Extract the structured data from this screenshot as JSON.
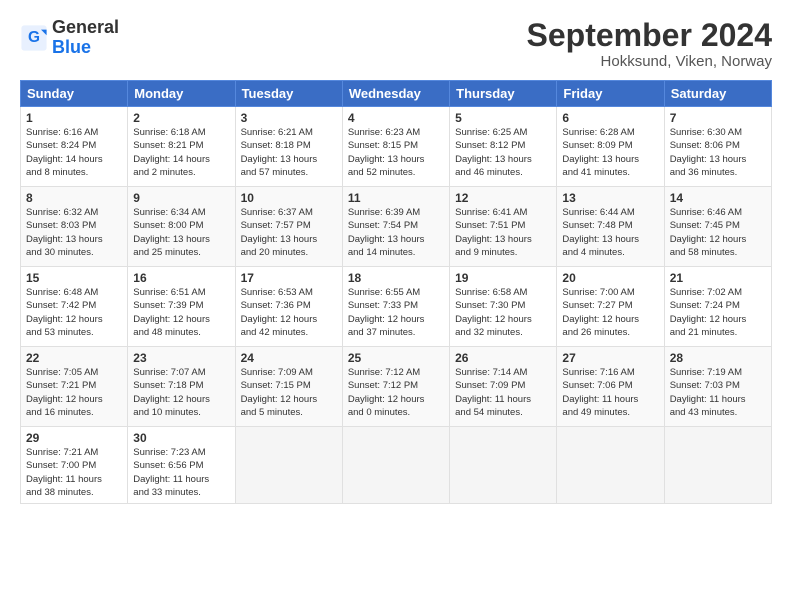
{
  "header": {
    "logo_general": "General",
    "logo_blue": "Blue",
    "month_title": "September 2024",
    "location": "Hokksund, Viken, Norway"
  },
  "weekdays": [
    "Sunday",
    "Monday",
    "Tuesday",
    "Wednesday",
    "Thursday",
    "Friday",
    "Saturday"
  ],
  "weeks": [
    [
      {
        "day": "1",
        "info": "Sunrise: 6:16 AM\nSunset: 8:24 PM\nDaylight: 14 hours\nand 8 minutes."
      },
      {
        "day": "2",
        "info": "Sunrise: 6:18 AM\nSunset: 8:21 PM\nDaylight: 14 hours\nand 2 minutes."
      },
      {
        "day": "3",
        "info": "Sunrise: 6:21 AM\nSunset: 8:18 PM\nDaylight: 13 hours\nand 57 minutes."
      },
      {
        "day": "4",
        "info": "Sunrise: 6:23 AM\nSunset: 8:15 PM\nDaylight: 13 hours\nand 52 minutes."
      },
      {
        "day": "5",
        "info": "Sunrise: 6:25 AM\nSunset: 8:12 PM\nDaylight: 13 hours\nand 46 minutes."
      },
      {
        "day": "6",
        "info": "Sunrise: 6:28 AM\nSunset: 8:09 PM\nDaylight: 13 hours\nand 41 minutes."
      },
      {
        "day": "7",
        "info": "Sunrise: 6:30 AM\nSunset: 8:06 PM\nDaylight: 13 hours\nand 36 minutes."
      }
    ],
    [
      {
        "day": "8",
        "info": "Sunrise: 6:32 AM\nSunset: 8:03 PM\nDaylight: 13 hours\nand 30 minutes."
      },
      {
        "day": "9",
        "info": "Sunrise: 6:34 AM\nSunset: 8:00 PM\nDaylight: 13 hours\nand 25 minutes."
      },
      {
        "day": "10",
        "info": "Sunrise: 6:37 AM\nSunset: 7:57 PM\nDaylight: 13 hours\nand 20 minutes."
      },
      {
        "day": "11",
        "info": "Sunrise: 6:39 AM\nSunset: 7:54 PM\nDaylight: 13 hours\nand 14 minutes."
      },
      {
        "day": "12",
        "info": "Sunrise: 6:41 AM\nSunset: 7:51 PM\nDaylight: 13 hours\nand 9 minutes."
      },
      {
        "day": "13",
        "info": "Sunrise: 6:44 AM\nSunset: 7:48 PM\nDaylight: 13 hours\nand 4 minutes."
      },
      {
        "day": "14",
        "info": "Sunrise: 6:46 AM\nSunset: 7:45 PM\nDaylight: 12 hours\nand 58 minutes."
      }
    ],
    [
      {
        "day": "15",
        "info": "Sunrise: 6:48 AM\nSunset: 7:42 PM\nDaylight: 12 hours\nand 53 minutes."
      },
      {
        "day": "16",
        "info": "Sunrise: 6:51 AM\nSunset: 7:39 PM\nDaylight: 12 hours\nand 48 minutes."
      },
      {
        "day": "17",
        "info": "Sunrise: 6:53 AM\nSunset: 7:36 PM\nDaylight: 12 hours\nand 42 minutes."
      },
      {
        "day": "18",
        "info": "Sunrise: 6:55 AM\nSunset: 7:33 PM\nDaylight: 12 hours\nand 37 minutes."
      },
      {
        "day": "19",
        "info": "Sunrise: 6:58 AM\nSunset: 7:30 PM\nDaylight: 12 hours\nand 32 minutes."
      },
      {
        "day": "20",
        "info": "Sunrise: 7:00 AM\nSunset: 7:27 PM\nDaylight: 12 hours\nand 26 minutes."
      },
      {
        "day": "21",
        "info": "Sunrise: 7:02 AM\nSunset: 7:24 PM\nDaylight: 12 hours\nand 21 minutes."
      }
    ],
    [
      {
        "day": "22",
        "info": "Sunrise: 7:05 AM\nSunset: 7:21 PM\nDaylight: 12 hours\nand 16 minutes."
      },
      {
        "day": "23",
        "info": "Sunrise: 7:07 AM\nSunset: 7:18 PM\nDaylight: 12 hours\nand 10 minutes."
      },
      {
        "day": "24",
        "info": "Sunrise: 7:09 AM\nSunset: 7:15 PM\nDaylight: 12 hours\nand 5 minutes."
      },
      {
        "day": "25",
        "info": "Sunrise: 7:12 AM\nSunset: 7:12 PM\nDaylight: 12 hours\nand 0 minutes."
      },
      {
        "day": "26",
        "info": "Sunrise: 7:14 AM\nSunset: 7:09 PM\nDaylight: 11 hours\nand 54 minutes."
      },
      {
        "day": "27",
        "info": "Sunrise: 7:16 AM\nSunset: 7:06 PM\nDaylight: 11 hours\nand 49 minutes."
      },
      {
        "day": "28",
        "info": "Sunrise: 7:19 AM\nSunset: 7:03 PM\nDaylight: 11 hours\nand 43 minutes."
      }
    ],
    [
      {
        "day": "29",
        "info": "Sunrise: 7:21 AM\nSunset: 7:00 PM\nDaylight: 11 hours\nand 38 minutes."
      },
      {
        "day": "30",
        "info": "Sunrise: 7:23 AM\nSunset: 6:56 PM\nDaylight: 11 hours\nand 33 minutes."
      },
      {
        "day": "",
        "info": ""
      },
      {
        "day": "",
        "info": ""
      },
      {
        "day": "",
        "info": ""
      },
      {
        "day": "",
        "info": ""
      },
      {
        "day": "",
        "info": ""
      }
    ]
  ]
}
